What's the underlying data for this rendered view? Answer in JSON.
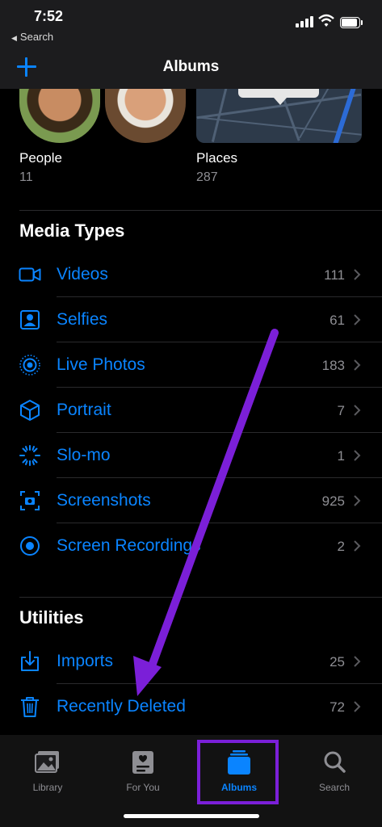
{
  "status": {
    "time": "7:52",
    "back_label": "Search"
  },
  "nav": {
    "title": "Albums"
  },
  "people": {
    "label": "People",
    "count": "11"
  },
  "places": {
    "label": "Places",
    "count": "287"
  },
  "media_types": {
    "title": "Media Types",
    "items": [
      {
        "label": "Videos",
        "count": "111",
        "icon": "video-icon"
      },
      {
        "label": "Selfies",
        "count": "61",
        "icon": "selfie-icon"
      },
      {
        "label": "Live Photos",
        "count": "183",
        "icon": "live-photos-icon"
      },
      {
        "label": "Portrait",
        "count": "7",
        "icon": "portrait-cube-icon"
      },
      {
        "label": "Slo-mo",
        "count": "1",
        "icon": "slomo-icon"
      },
      {
        "label": "Screenshots",
        "count": "925",
        "icon": "screenshot-icon"
      },
      {
        "label": "Screen Recordings",
        "count": "2",
        "icon": "screen-recording-icon"
      }
    ]
  },
  "utilities": {
    "title": "Utilities",
    "items": [
      {
        "label": "Imports",
        "count": "25",
        "icon": "import-tray-icon"
      },
      {
        "label": "Recently Deleted",
        "count": "72",
        "icon": "trash-icon"
      }
    ]
  },
  "tabbar": {
    "tabs": [
      {
        "label": "Library",
        "icon": "library-photos-icon",
        "active": false
      },
      {
        "label": "For You",
        "icon": "for-you-icon",
        "active": false
      },
      {
        "label": "Albums",
        "icon": "albums-stack-icon",
        "active": true
      },
      {
        "label": "Search",
        "icon": "magnifier-icon",
        "active": false
      }
    ]
  },
  "colors": {
    "accent": "#0a84ff",
    "annotation": "#7b1fd8",
    "secondary_text": "#8e8e93"
  }
}
